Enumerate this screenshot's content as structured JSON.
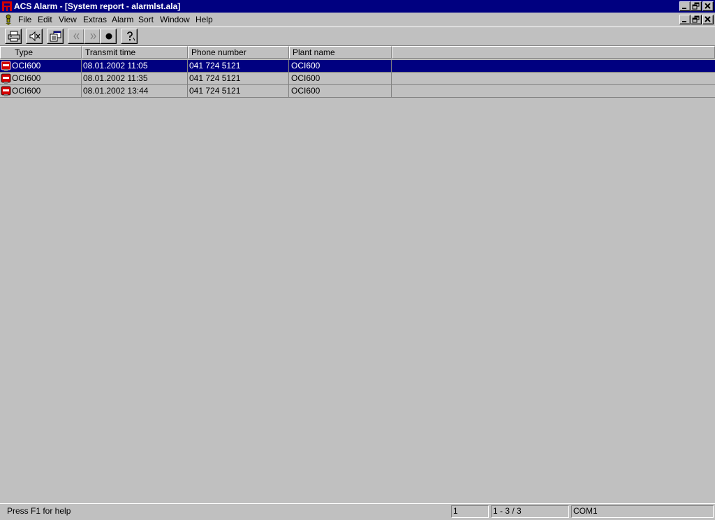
{
  "window": {
    "title": "ACS Alarm - [System report - alarmlst.ala]"
  },
  "menu": {
    "items": [
      {
        "label": "File"
      },
      {
        "label": "Edit"
      },
      {
        "label": "View"
      },
      {
        "label": "Extras"
      },
      {
        "label": "Alarm"
      },
      {
        "label": "Sort"
      },
      {
        "label": "Window"
      },
      {
        "label": "Help"
      }
    ]
  },
  "toolbar": {
    "buttons": [
      {
        "icon": "printer-icon"
      },
      {
        "icon": "speaker-mute-icon"
      },
      {
        "icon": "properties-icon"
      },
      {
        "icon": "previous-icon",
        "enabled": false
      },
      {
        "icon": "next-icon",
        "enabled": false
      },
      {
        "icon": "record-icon"
      },
      {
        "icon": "help-icon"
      }
    ]
  },
  "list": {
    "columns": [
      "Type",
      "Transmit time",
      "Phone number",
      "Plant name"
    ],
    "rows": [
      {
        "type": "OCI600",
        "transmit_time": "08.01.2002 11:05",
        "phone": "041 724 5121",
        "plant": "OCI600",
        "selected": true
      },
      {
        "type": "OCI600",
        "transmit_time": "08.01.2002 11:35",
        "phone": "041 724 5121",
        "plant": "OCI600",
        "selected": false
      },
      {
        "type": "OCI600",
        "transmit_time": "08.01.2002 13:44",
        "phone": "041 724 5121",
        "plant": "OCI600",
        "selected": false
      }
    ]
  },
  "status": {
    "help_text": "Press F1 for help",
    "pane1": "1",
    "pane2": "1 - 3 / 3",
    "pane3": "COM1"
  },
  "colors": {
    "titlebar": "#000080",
    "selection": "#000080",
    "face": "#c0c0c0",
    "alarm_icon": "#d40000"
  }
}
